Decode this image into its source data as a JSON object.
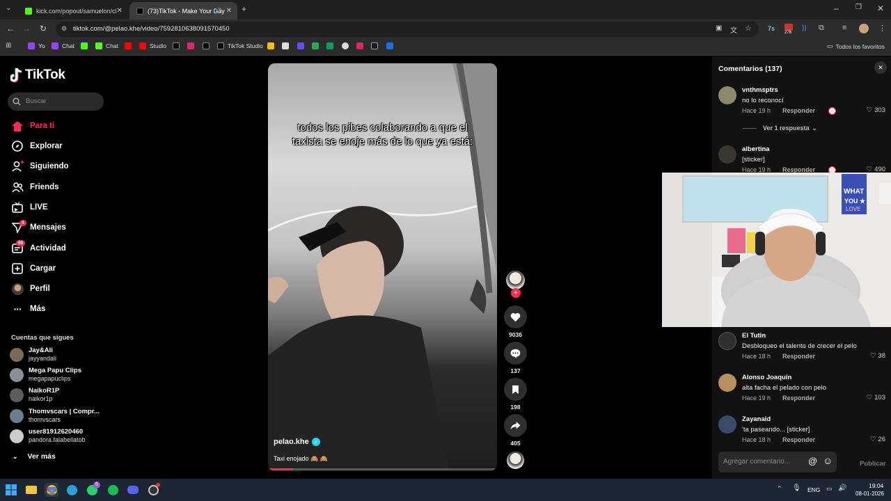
{
  "browser": {
    "tabs": [
      {
        "title": "kick.com/popout/samuelon/cha",
        "active": false
      },
      {
        "title": "(73)TikTok - Make Your Day",
        "active": true
      }
    ],
    "url": "tiktok.com/@pelao.khe/video/7592810638091570450",
    "extension_badge": "276",
    "bookmarks": [
      "Yo",
      "Chat",
      "Chat",
      "Studio",
      "TikTok Studio"
    ],
    "all_bookmarks": "Todos los favoritos"
  },
  "sidebar": {
    "logo": "TikTok",
    "search_placeholder": "Buscar",
    "nav": [
      {
        "label": "Para ti",
        "active": true
      },
      {
        "label": "Explorar"
      },
      {
        "label": "Siguiendo"
      },
      {
        "label": "Friends"
      },
      {
        "label": "LIVE"
      },
      {
        "label": "Mensajes",
        "badge": "4"
      },
      {
        "label": "Actividad",
        "badge": "99"
      },
      {
        "label": "Cargar"
      },
      {
        "label": "Perfil"
      },
      {
        "label": "Más"
      }
    ],
    "following_title": "Cuentas que sigues",
    "accounts": [
      {
        "name": "Jay&Ali",
        "handle": "jayyandali"
      },
      {
        "name": "Mega Papu Clips",
        "handle": "megapapuclips"
      },
      {
        "name": "NaikoR1P",
        "handle": "naikor1p"
      },
      {
        "name": "Thomvscars | Compr...",
        "handle": "thomvscars"
      },
      {
        "name": "user81912620460",
        "handle": "pandora.falabellatob"
      }
    ],
    "see_more": "Ver más"
  },
  "video": {
    "caption_overlay": "todos los pibes colaborando a que el taxista se enoje más de lo que ya está:",
    "author": "pelao.khe",
    "description": "Taxi enojado 🙈 🙈",
    "progress": 0.11
  },
  "actions": {
    "likes": "9036",
    "comments": "137",
    "saves": "198",
    "shares": "405"
  },
  "comments_panel": {
    "title": "Comentarios (137)",
    "view_replies": "Ver 1 respuesta",
    "input_placeholder": "Agregar comentario...",
    "post_label": "Publicar",
    "comments": [
      {
        "user": "vnthmsptrs",
        "text": "no lo reconocí",
        "date": "Hace 19 h",
        "reply": "Responder",
        "likes": "303"
      },
      {
        "user": "albertina",
        "text": "[sticker]",
        "date": "Hace 19 h",
        "reply": "Responder",
        "likes": "490"
      },
      {
        "user": "El Tutin",
        "text": "Desbloqueo el talento de crecer el pelo",
        "date": "Hace 18 h",
        "reply": "Responder",
        "likes": "38"
      },
      {
        "user": "Alonso Joaquín",
        "text": "alta facha el pelado con pelo",
        "date": "Hace 19 h",
        "reply": "Responder",
        "likes": "103"
      },
      {
        "user": "Zayanaid",
        "text": "'ta paseando... [sticker]",
        "date": "Hace 18 h",
        "reply": "Responder",
        "likes": "26"
      }
    ]
  },
  "webcam": {
    "sign_text": "WHAT YOU LOVE"
  },
  "taskbar": {
    "language": "ENG",
    "time": "19:04",
    "date": "08-01-2026",
    "whatsapp_badge": "5"
  },
  "colors": {
    "accent": "#fe2c55",
    "verified": "#20d5ec",
    "panel": "#121212"
  }
}
